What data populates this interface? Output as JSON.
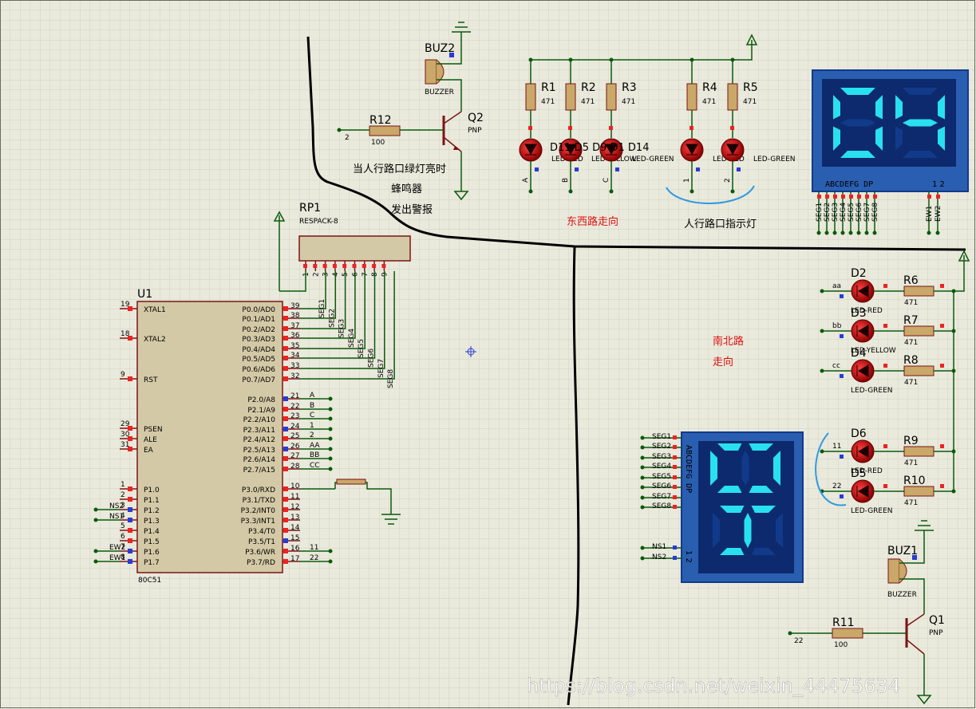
{
  "u1": {
    "ref": "U1",
    "type": "80C51",
    "left_pins": [
      {
        "num": "19",
        "name": "XTAL1",
        "net": ""
      },
      {
        "num": "18",
        "name": "XTAL2",
        "net": ""
      },
      {
        "num": "9",
        "name": "RST",
        "net": ""
      },
      {
        "num": "29",
        "name": "PSEN",
        "net": ""
      },
      {
        "num": "30",
        "name": "ALE",
        "net": ""
      },
      {
        "num": "31",
        "name": "EA",
        "net": ""
      },
      {
        "num": "1",
        "name": "P1.0",
        "net": ""
      },
      {
        "num": "2",
        "name": "P1.1",
        "net": ""
      },
      {
        "num": "3",
        "name": "P1.2",
        "net": "NS2"
      },
      {
        "num": "4",
        "name": "P1.3",
        "net": "NS1"
      },
      {
        "num": "5",
        "name": "P1.4",
        "net": ""
      },
      {
        "num": "6",
        "name": "P1.5",
        "net": ""
      },
      {
        "num": "7",
        "name": "P1.6",
        "net": "EW2"
      },
      {
        "num": "8",
        "name": "P1.7",
        "net": "EW1"
      }
    ],
    "right_pins": [
      {
        "num": "39",
        "name": "P0.0/AD0",
        "net": "SEG1"
      },
      {
        "num": "38",
        "name": "P0.1/AD1",
        "net": "SEG2"
      },
      {
        "num": "37",
        "name": "P0.2/AD2",
        "net": "SEG3"
      },
      {
        "num": "36",
        "name": "P0.3/AD3",
        "net": "SEG4"
      },
      {
        "num": "35",
        "name": "P0.4/AD4",
        "net": "SEG5"
      },
      {
        "num": "34",
        "name": "P0.5/AD5",
        "net": "SEG6"
      },
      {
        "num": "33",
        "name": "P0.6/AD6",
        "net": "SEG7"
      },
      {
        "num": "32",
        "name": "P0.7/AD7",
        "net": "SEG8"
      },
      {
        "num": "21",
        "name": "P2.0/A8",
        "net": "A"
      },
      {
        "num": "22",
        "name": "P2.1/A9",
        "net": "B"
      },
      {
        "num": "23",
        "name": "P2.2/A10",
        "net": "C"
      },
      {
        "num": "24",
        "name": "P2.3/A11",
        "net": "1"
      },
      {
        "num": "25",
        "name": "P2.4/A12",
        "net": "2"
      },
      {
        "num": "26",
        "name": "P2.5/A13",
        "net": "AA"
      },
      {
        "num": "27",
        "name": "P2.6/A14",
        "net": "BB"
      },
      {
        "num": "28",
        "name": "P2.7/A15",
        "net": "CC"
      },
      {
        "num": "10",
        "name": "P3.0/RXD",
        "net": ""
      },
      {
        "num": "11",
        "name": "P3.1/TXD",
        "net": ""
      },
      {
        "num": "12",
        "name": "P3.2/INT0",
        "net": ""
      },
      {
        "num": "13",
        "name": "P3.3/INT1",
        "net": ""
      },
      {
        "num": "14",
        "name": "P3.4/T0",
        "net": ""
      },
      {
        "num": "15",
        "name": "P3.5/T1",
        "net": ""
      },
      {
        "num": "16",
        "name": "P3.6/WR",
        "net": "11"
      },
      {
        "num": "17",
        "name": "P3.7/RD",
        "net": "22"
      }
    ]
  },
  "rp1": {
    "ref": "RP1",
    "type": "RESPACK-8",
    "pins": [
      "1",
      "2",
      "3",
      "4",
      "5",
      "6",
      "7",
      "8",
      "9"
    ]
  },
  "buz2": {
    "ref": "BUZ2",
    "type": "BUZZER"
  },
  "q2": {
    "ref": "Q2",
    "type": "PNP"
  },
  "r12": {
    "ref": "R12",
    "value": "100",
    "net": "2"
  },
  "buz1": {
    "ref": "BUZ1",
    "type": "BUZZER"
  },
  "q1": {
    "ref": "Q1",
    "type": "PNP"
  },
  "r11": {
    "ref": "R11",
    "value": "100",
    "net": "22"
  },
  "top_resistors": [
    {
      "ref": "R1",
      "value": "471"
    },
    {
      "ref": "R2",
      "value": "471"
    },
    {
      "ref": "R3",
      "value": "471"
    },
    {
      "ref": "R4",
      "value": "471"
    },
    {
      "ref": "R5",
      "value": "471"
    }
  ],
  "top_leds_label": "D11 D5 D9 D1 D14",
  "top_led_texts": [
    "LED-RED",
    "LED-YELLOW",
    "LED-GREEN",
    "LED-RED",
    "LED-GREEN"
  ],
  "top_led_nets": [
    "A",
    "B",
    "C",
    "1",
    "2"
  ],
  "right_resistors": [
    {
      "ref": "R6",
      "value": "471"
    },
    {
      "ref": "R7",
      "value": "471"
    },
    {
      "ref": "R8",
      "value": "471"
    },
    {
      "ref": "R9",
      "value": "471"
    },
    {
      "ref": "R10",
      "value": "471"
    }
  ],
  "right_leds": [
    {
      "ref": "D2",
      "type": "LED-RED",
      "net": "aa"
    },
    {
      "ref": "D3",
      "type": "LED-YELLOW",
      "net": "bb"
    },
    {
      "ref": "D4",
      "type": "LED-GREEN",
      "net": "cc"
    },
    {
      "ref": "D6",
      "type": "LED-RED",
      "net": "11"
    },
    {
      "ref": "D5",
      "type": "LED-GREEN",
      "net": "22"
    }
  ],
  "display_top": {
    "digits": "04",
    "segment_labels": "ABCDEFG DP",
    "digit_pins": "1 2",
    "pins": [
      "SEG1",
      "SEG2",
      "SEG3",
      "SEG4",
      "SEG5",
      "SEG6",
      "SEG7",
      "SEG8",
      "EW1",
      "EW2"
    ]
  },
  "display_bottom": {
    "digits": "04",
    "segment_labels": "ABCDEFG DP",
    "digit_pins": "1 2",
    "pins": [
      "SEG1",
      "SEG2",
      "SEG3",
      "SEG4",
      "SEG5",
      "SEG6",
      "SEG7",
      "SEG8",
      "NS1",
      "NS2"
    ]
  },
  "annotations": {
    "buzzer_note_1": "当人行路口绿灯亮时",
    "buzzer_note_2": "蜂鸣器",
    "buzzer_note_3": "发出警报",
    "ew_road": "东西路走向",
    "pedestrian": "人行路口指示灯",
    "ns_road_1": "南北路",
    "ns_road_2": "走向"
  },
  "watermark": "https://blog.csdn.net/weixin_44475634",
  "colors": {
    "background": "#e9e9dc",
    "grid": "#d2d2c4",
    "wire": "#0b5a0b",
    "component": "#8b1a1a",
    "display_bg": "#0d2a6e",
    "segment_on": "#28e0f0",
    "annotation": "#d11111"
  }
}
